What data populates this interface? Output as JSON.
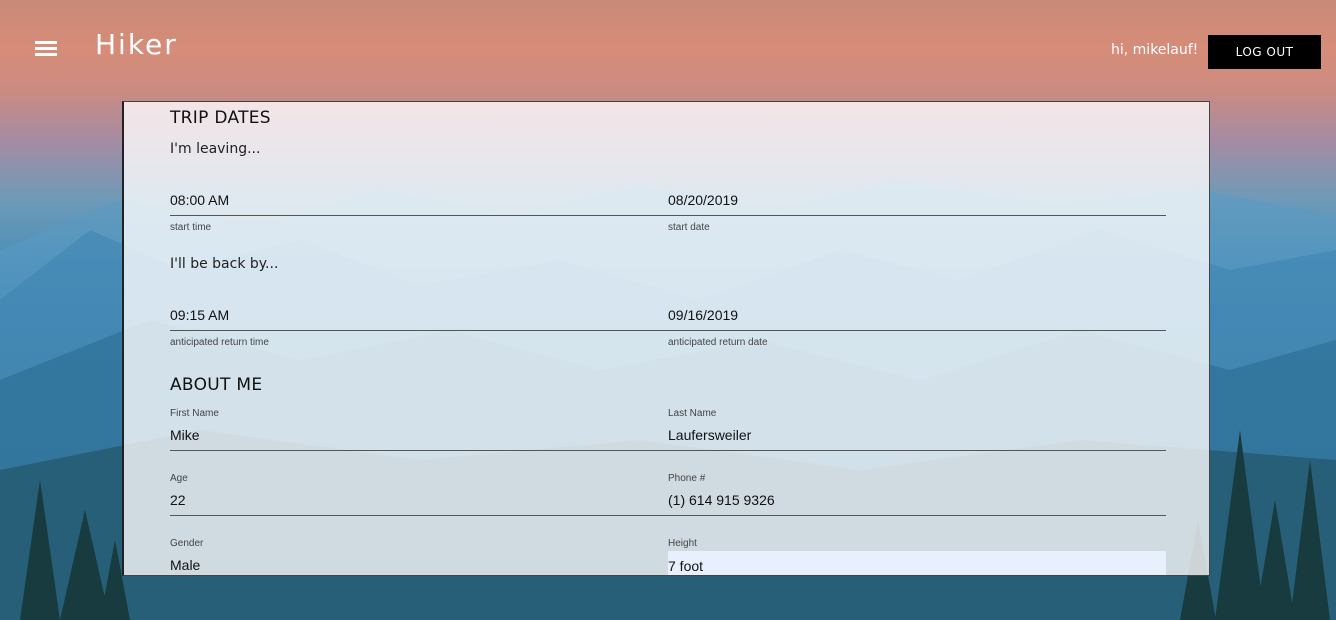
{
  "header": {
    "app_title": "Hiker",
    "greeting": "hi, mikelauf!",
    "logout_label": "LOG OUT"
  },
  "trip_dates": {
    "title": "TRIP DATES",
    "leaving_text": "I'm leaving...",
    "start_time": {
      "value": "08:00 AM",
      "helper": "start time"
    },
    "start_date": {
      "value": "08/20/2019",
      "helper": "start date"
    },
    "back_text": "I'll be back by...",
    "return_time": {
      "value": "09:15 AM",
      "helper": "anticipated return time"
    },
    "return_date": {
      "value": "09/16/2019",
      "helper": "anticipated return date"
    }
  },
  "about_me": {
    "title": "ABOUT ME",
    "first_name": {
      "label": "First Name",
      "value": "Mike"
    },
    "last_name": {
      "label": "Last Name",
      "value": "Laufersweiler"
    },
    "age": {
      "label": "Age",
      "value": "22"
    },
    "phone": {
      "label": "Phone #",
      "value": "(1) 614 915 9326"
    },
    "gender": {
      "label": "Gender",
      "value": "Male"
    },
    "height": {
      "label": "Height",
      "value": "7 foot"
    }
  },
  "icons": [
    "menu-icon"
  ]
}
